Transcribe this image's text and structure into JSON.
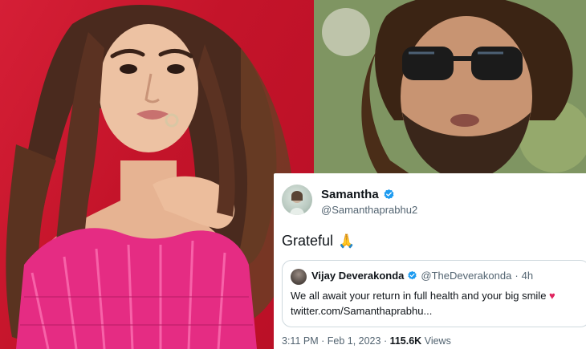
{
  "tweet": {
    "author_name": "Samantha",
    "author_handle": "@Samanthaprabhu2",
    "text": "Grateful",
    "emoji": "🙏",
    "verified_icon": "verified-badge-icon",
    "quoted": {
      "author_name": "Vijay Deverakonda",
      "author_handle": "@TheDeverakonda",
      "separator": "·",
      "time": "4h",
      "text_line1": "We all await your return in full health and your big smile",
      "heart": "♥",
      "text_line2": "twitter.com/Samanthaprabhu..."
    },
    "timestamp": "3:11 PM · Feb 1, 2023",
    "meta_separator": "·",
    "views_count": "115.6K",
    "views_label": "Views"
  },
  "colors": {
    "verified": "#1d9bf0",
    "text": "#0f1419",
    "muted": "#536471",
    "left_bg": "#d51f36",
    "heart": "#e0245e"
  }
}
